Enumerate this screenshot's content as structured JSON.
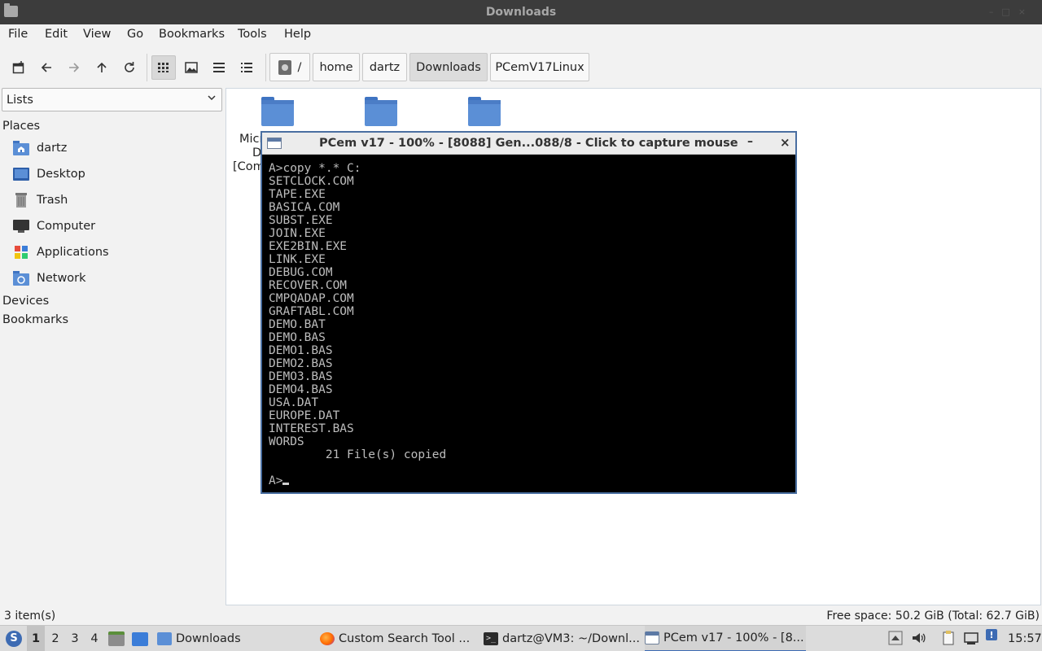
{
  "window": {
    "title": "Downloads"
  },
  "menu": [
    "File",
    "Edit",
    "View",
    "Go",
    "Bookmarks",
    "Tools",
    "Help"
  ],
  "breadcrumbs": [
    "/",
    "home",
    "dartz",
    "Downloads",
    "PCemV17Linux"
  ],
  "sidebar": {
    "selector": "Lists",
    "places_heading": "Places",
    "places": [
      {
        "label": "dartz",
        "icon": "home-folder-icon"
      },
      {
        "label": "Desktop",
        "icon": "desktop-icon"
      },
      {
        "label": "Trash",
        "icon": "trash-icon"
      },
      {
        "label": "Computer",
        "icon": "computer-icon"
      },
      {
        "label": "Applications",
        "icon": "applications-icon"
      },
      {
        "label": "Network",
        "icon": "network-icon"
      }
    ],
    "devices_heading": "Devices",
    "bookmarks_heading": "Bookmarks"
  },
  "files": [
    {
      "label_lines": [
        "Micr",
        "D",
        "[Com"
      ]
    },
    {
      "label_lines": []
    },
    {
      "label_lines": []
    }
  ],
  "pcem": {
    "title": "PCem v17 - 100% - [8088] Gen...088/8 - Click to capture mouse",
    "minimize": "–",
    "close": "×",
    "console": [
      "A>copy *.* C:",
      "SETCLOCK.COM",
      "TAPE.EXE",
      "BASICA.COM",
      "SUBST.EXE",
      "JOIN.EXE",
      "EXE2BIN.EXE",
      "LINK.EXE",
      "DEBUG.COM",
      "RECOVER.COM",
      "CMPQADAP.COM",
      "GRAFTABL.COM",
      "DEMO.BAT",
      "DEMO.BAS",
      "DEMO1.BAS",
      "DEMO2.BAS",
      "DEMO3.BAS",
      "DEMO4.BAS",
      "USA.DAT",
      "EUROPE.DAT",
      "INTEREST.BAS",
      "WORDS",
      "        21 File(s) copied",
      "",
      "A>"
    ]
  },
  "status": {
    "items": "3 item(s)",
    "free": "Free space: 50.2 GiB (Total: 62.7 GiB)"
  },
  "taskbar": {
    "workspaces": [
      "1",
      "2",
      "3",
      "4"
    ],
    "tasks": [
      {
        "label": "Downloads"
      },
      {
        "label": "Custom Search Tool ..."
      },
      {
        "label": "dartz@VM3: ~/Downl..."
      },
      {
        "label": "PCem v17 - 100% - [8..."
      }
    ],
    "clock": "15:57"
  },
  "colors": {
    "folder": "#5b8fd6",
    "accent": "#3d6bb3",
    "titlebar": "#3c3c3c"
  }
}
